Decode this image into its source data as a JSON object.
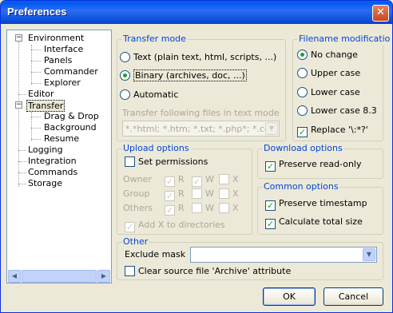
{
  "window": {
    "title": "Preferences",
    "close_glyph": "✕"
  },
  "tree": {
    "items": [
      {
        "label": "Environment",
        "level": 0,
        "expander": "−"
      },
      {
        "label": "Interface",
        "level": 1
      },
      {
        "label": "Panels",
        "level": 1
      },
      {
        "label": "Commander",
        "level": 1
      },
      {
        "label": "Explorer",
        "level": 1
      },
      {
        "label": "Editor",
        "level": 0
      },
      {
        "label": "Transfer",
        "level": 0,
        "expander": "−",
        "selected": true
      },
      {
        "label": "Drag & Drop",
        "level": 1
      },
      {
        "label": "Background",
        "level": 1
      },
      {
        "label": "Resume",
        "level": 1
      },
      {
        "label": "Logging",
        "level": 0
      },
      {
        "label": "Integration",
        "level": 0
      },
      {
        "label": "Commands",
        "level": 0
      },
      {
        "label": "Storage",
        "level": 0
      }
    ]
  },
  "transfer_mode": {
    "title": "Transfer mode",
    "text_option": "Text (plain text, html, scripts, ...)",
    "binary_option": "Binary (archives, doc, ...)",
    "automatic_option": "Automatic",
    "selected": "binary",
    "files_label": "Transfer following files in text mode",
    "files_value": "*.*html; *.htm; *.txt; *.php*; *.cgi; *.",
    "files_enabled": false
  },
  "filename_mod": {
    "title": "Filename modificatio",
    "options": [
      "No change",
      "Upper case",
      "Lower case",
      "Lower case 8.3"
    ],
    "selected": "No change",
    "replace_label": "Replace '\\:*?'",
    "replace_checked": true
  },
  "upload": {
    "title": "Upload options",
    "set_permissions": "Set permissions",
    "set_permissions_checked": false,
    "rows": [
      "Owner",
      "Group",
      "Others"
    ],
    "cols": [
      "R",
      "W",
      "X"
    ],
    "add_x": "Add X to directories"
  },
  "download": {
    "title": "Download options",
    "preserve_readonly": "Preserve read-only",
    "preserve_readonly_checked": true
  },
  "common": {
    "title": "Common options",
    "preserve_timestamp": "Preserve timestamp",
    "calculate_size": "Calculate total size"
  },
  "other": {
    "title": "Other",
    "exclude_mask_label": "Exclude mask",
    "exclude_mask_value": "",
    "clear_archive": "Clear source file 'Archive' attribute",
    "clear_archive_checked": false
  },
  "buttons": {
    "ok": "OK",
    "cancel": "Cancel"
  },
  "glyphs": {
    "check": "✓",
    "down_arrow": "▼",
    "left_arrow": "◀",
    "right_arrow": "▶"
  }
}
